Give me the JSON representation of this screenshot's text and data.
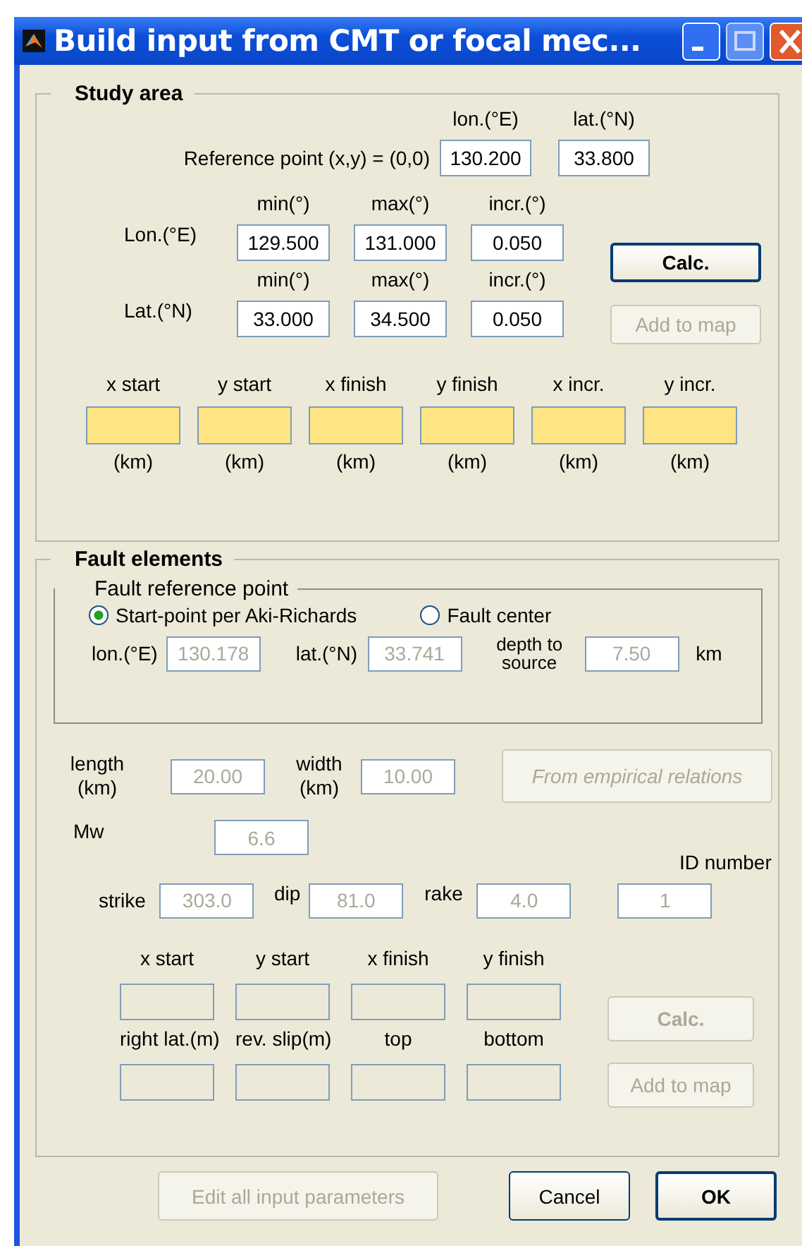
{
  "window": {
    "title": "Build input from CMT or focal mec..."
  },
  "study_area": {
    "title": "Study area",
    "reference_point": {
      "label": "Reference point (x,y) = (0,0)",
      "headers": [
        "lon.(°E)",
        "lat.(°N)"
      ],
      "values": [
        "130.200",
        "33.800"
      ]
    },
    "grid_rows": [
      {
        "label": "Lon.(°E)",
        "headers": [
          "min(°)",
          "max(°)",
          "incr.(°)"
        ],
        "values": [
          "129.500",
          "131.000",
          "0.050"
        ]
      },
      {
        "label": "Lat.(°N)",
        "headers": [
          "min(°)",
          "max(°)",
          "incr.(°)"
        ],
        "values": [
          "33.000",
          "34.500",
          "0.050"
        ]
      }
    ],
    "buttons": [
      {
        "label": "Calc.",
        "disabled": false,
        "bold": true
      },
      {
        "label": "Add to map",
        "disabled": true,
        "bold": false
      }
    ],
    "km_fields": [
      {
        "label": "x start",
        "unit": "(km)"
      },
      {
        "label": "y start",
        "unit": "(km)"
      },
      {
        "label": "x finish",
        "unit": "(km)"
      },
      {
        "label": "y finish",
        "unit": "(km)"
      },
      {
        "label": "x incr.",
        "unit": "(km)"
      },
      {
        "label": "y incr.",
        "unit": "(km)"
      }
    ]
  },
  "fault_elements": {
    "title": "Fault elements",
    "fields_disabled": true,
    "reference_point": {
      "title": "Fault reference point",
      "options": [
        {
          "label": "Start-point per Aki-Richards",
          "selected": true
        },
        {
          "label": "Fault center",
          "selected": false
        }
      ],
      "lon_label": "lon.(°E)",
      "lon": "130.178",
      "lat_label": "lat.(°N)",
      "lat": "33.741",
      "depth_label": "depth to source",
      "depth": "7.50",
      "depth_unit": "km"
    },
    "length": {
      "label": "length (km)",
      "value": "20.00"
    },
    "width": {
      "label": "width (km)",
      "value": "10.00"
    },
    "empirical_button": {
      "label": "From empirical relations",
      "disabled": true
    },
    "mw": {
      "label": "Mw",
      "value": "6.6"
    },
    "id_number": {
      "label": "ID number",
      "value": "1"
    },
    "angles": [
      {
        "label": "strike",
        "value": "303.0"
      },
      {
        "label": "dip",
        "value": "81.0"
      },
      {
        "label": "rake",
        "value": "4.0"
      }
    ],
    "coord_labels": [
      "x start",
      "y start",
      "x finish",
      "y finish"
    ],
    "slip_labels": [
      "right lat.(m)",
      "rev. slip(m)",
      "top",
      "bottom"
    ],
    "buttons": [
      {
        "label": "Calc.",
        "disabled": true,
        "bold": true
      },
      {
        "label": "Add to map",
        "disabled": true,
        "bold": false
      }
    ]
  },
  "buttons": [
    {
      "label": "Edit all input parameters",
      "disabled": true,
      "bold": false
    },
    {
      "label": "Cancel",
      "disabled": false,
      "bold": false
    },
    {
      "label": "OK",
      "disabled": false,
      "bold": true
    }
  ]
}
